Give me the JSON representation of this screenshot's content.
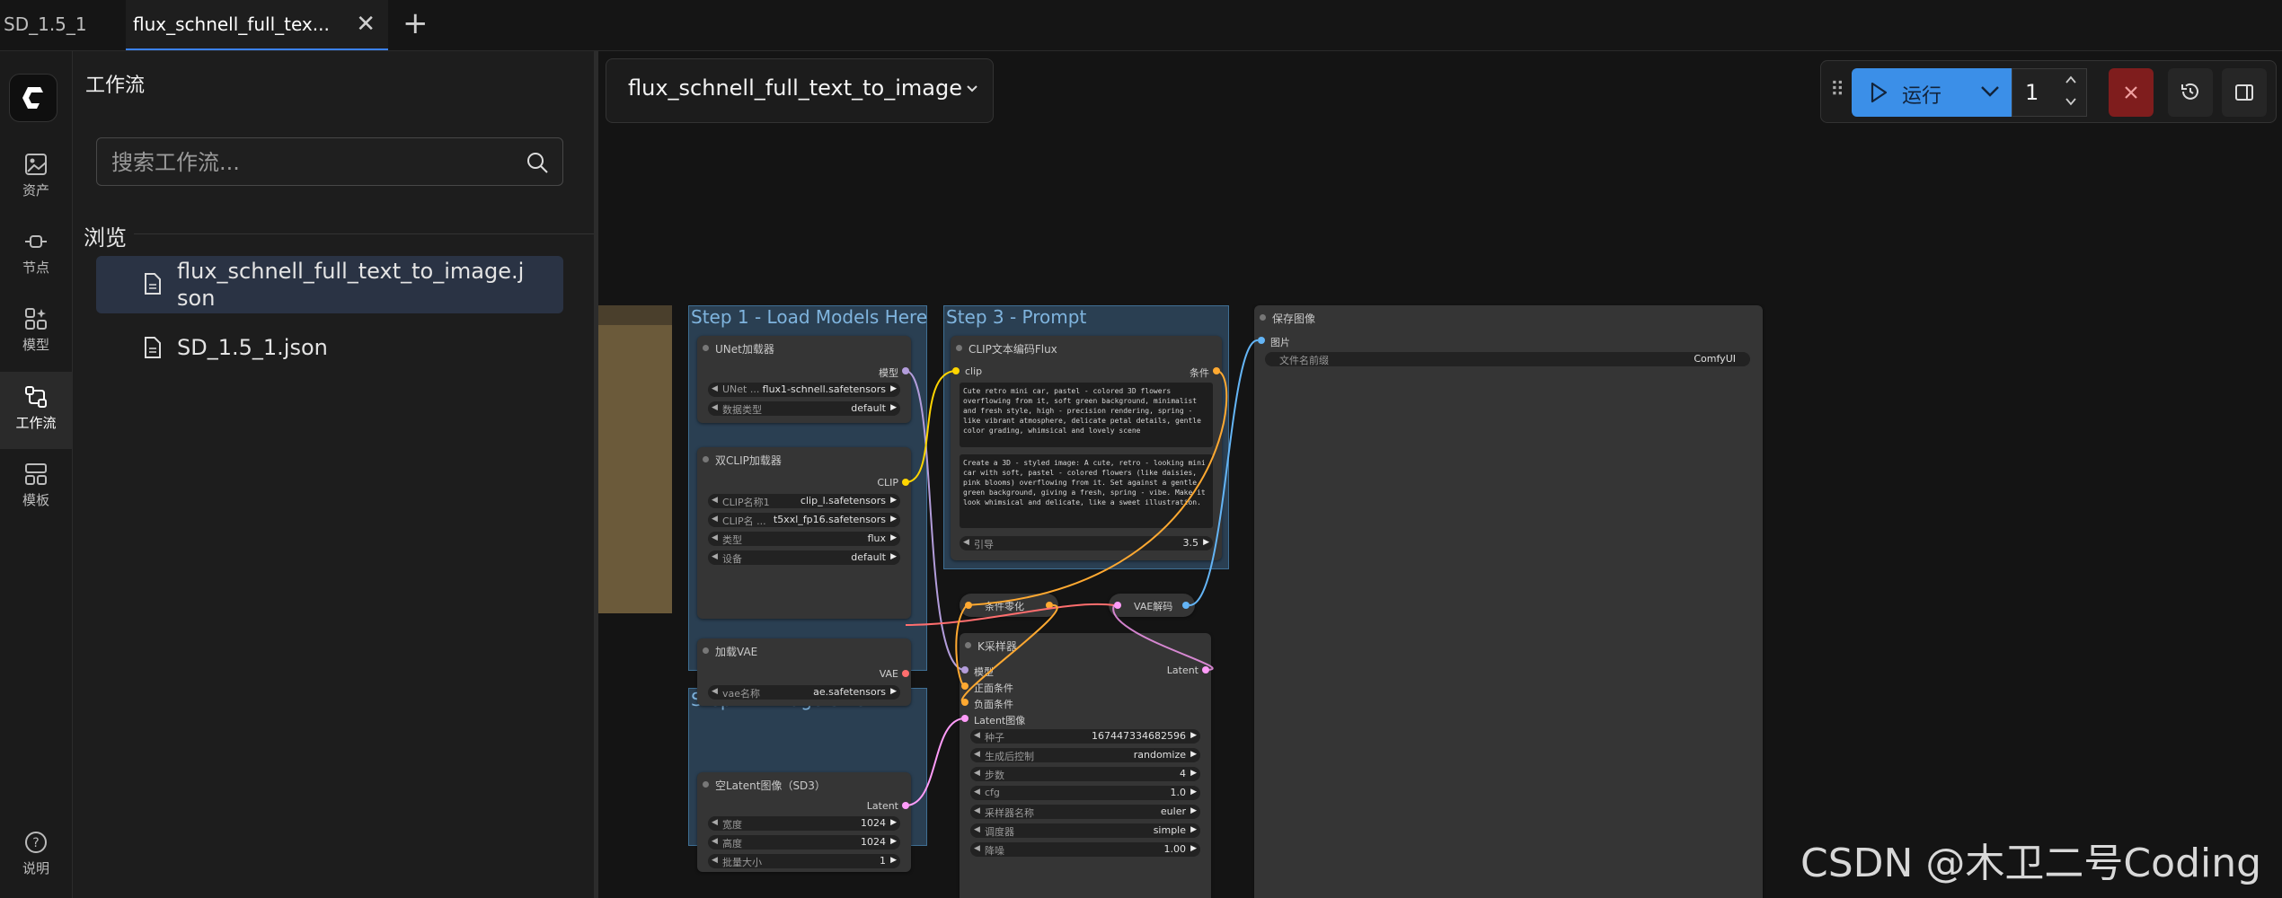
{
  "tabs": [
    {
      "label": "SD_1.5_1"
    },
    {
      "label": "flux_schnell_full_tex..."
    }
  ],
  "rail": {
    "items": [
      {
        "label": "资产",
        "icon": "image-icon"
      },
      {
        "label": "节点",
        "icon": "node-icon"
      },
      {
        "label": "模型",
        "icon": "model-icon"
      },
      {
        "label": "工作流",
        "icon": "workflow-icon"
      },
      {
        "label": "模板",
        "icon": "template-icon"
      }
    ],
    "help": "说明"
  },
  "panel": {
    "title": "工作流",
    "search_placeholder": "搜索工作流...",
    "browse": "浏览",
    "files": [
      "flux_schnell_full_text_to_image.json",
      "SD_1.5_1.json"
    ],
    "file1_line1": "flux_schnell_full_text_to_image.j",
    "file1_line2": "son"
  },
  "toolbar": {
    "workflow_name": "flux_schnell_full_text_to_image",
    "run_label": "运行",
    "batch_count": "1"
  },
  "groups": {
    "step1": "Step 1 - Load Models Here",
    "step2": "Step 2 - Image Size",
    "step3": "Step 3 - Prompt"
  },
  "nodes": {
    "unet": {
      "title": "UNet加载器",
      "out": "模型",
      "w1_label": "UNet ...",
      "w1_value": "flux1-schnell.safetensors",
      "w2_label": "数据类型",
      "w2_value": "default"
    },
    "dualclip": {
      "title": "双CLIP加载器",
      "out": "CLIP",
      "w1_label": "CLIP名称1",
      "w1_value": "clip_l.safetensors",
      "w2_label": "CLIP名 ...",
      "w2_value": "t5xxl_fp16.safetensors",
      "w3_label": "类型",
      "w3_value": "flux",
      "w4_label": "设备",
      "w4_value": "default"
    },
    "vae": {
      "title": "加载VAE",
      "out": "VAE",
      "w1_label": "vae名称",
      "w1_value": "ae.safetensors"
    },
    "latent": {
      "title": "空Latent图像（SD3）",
      "out": "Latent",
      "w1_label": "宽度",
      "w1_value": "1024",
      "w2_label": "高度",
      "w2_value": "1024",
      "w3_label": "批量大小",
      "w3_value": "1"
    },
    "clip_text": {
      "title": "CLIP文本编码Flux",
      "in": "clip",
      "out": "条件",
      "text1": "Cute retro mini car, pastel - colored 3D flowers overflowing from it, soft green background, minimalist and fresh style, high - precision rendering, spring - like vibrant atmosphere, delicate petal details, gentle color grading, whimsical and lovely scene",
      "text2": "Create a 3D - styled image: A cute, retro - looking mini car with soft, pastel - colored flowers (like daisies, pink blooms) overflowing from it. Set against a gentle green background, giving a fresh, spring - vibe. Make it look whimsical and delicate, like a sweet illustration.",
      "w1_label": "引导",
      "w1_value": "3.5"
    },
    "zero": {
      "title": "条件零化"
    },
    "vae_decode": {
      "title": "VAE解码"
    },
    "ksampler": {
      "title": "K采样器",
      "in1": "模型",
      "in2": "正面条件",
      "in3": "负面条件",
      "in4": "Latent图像",
      "out": "Latent",
      "widgets": [
        {
          "label": "种子",
          "value": "167447334682596"
        },
        {
          "label": "生成后控制",
          "value": "randomize"
        },
        {
          "label": "步数",
          "value": "4"
        },
        {
          "label": "cfg",
          "value": "1.0"
        },
        {
          "label": "采样器名称",
          "value": "euler"
        },
        {
          "label": "调度器",
          "value": "simple"
        },
        {
          "label": "降噪",
          "value": "1.00"
        }
      ]
    },
    "save": {
      "title": "保存图像",
      "in": "图片",
      "w1_label": "文件名前缀",
      "w1_value": "ComfyUI"
    }
  },
  "watermark": "CSDN @木卫二号Coding",
  "colors": {
    "accent": "#3b8fe8",
    "group_bg": "#2a3f52",
    "group_title": "#7fb4de",
    "stop": "#7f1d1d",
    "link_model": "#b39ddb",
    "link_clip": "#ffd500",
    "link_vae": "#ff6e6e",
    "link_cond": "#ffa931",
    "link_latent": "#ff9cf9",
    "link_image": "#64b5f6"
  }
}
